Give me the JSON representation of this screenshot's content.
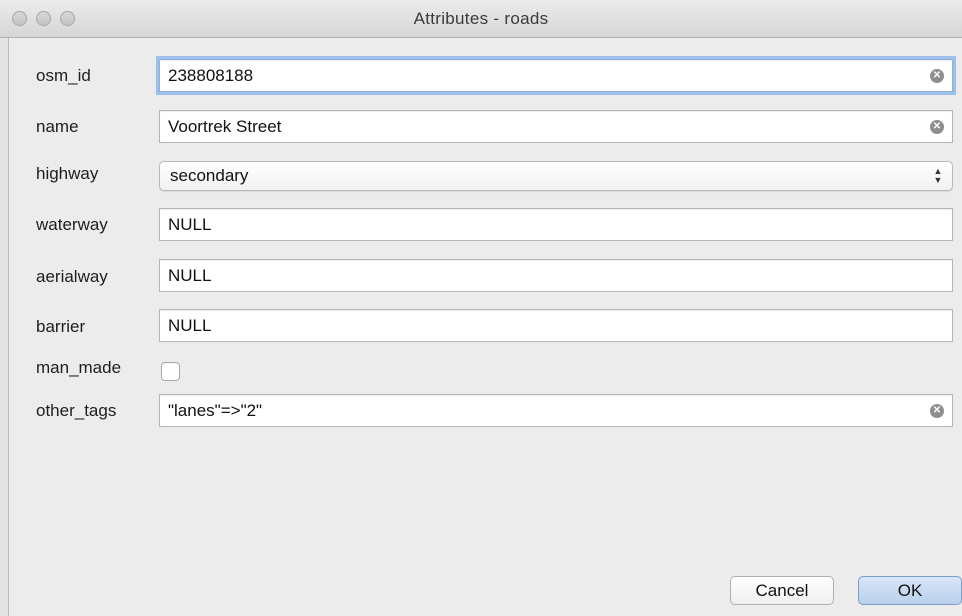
{
  "window": {
    "title": "Attributes - roads"
  },
  "fields": {
    "osm_id": {
      "label": "osm_id",
      "value": "238808188"
    },
    "name": {
      "label": "name",
      "value": "Voortrek Street"
    },
    "highway": {
      "label": "highway",
      "value": "secondary"
    },
    "waterway": {
      "label": "waterway",
      "value": "NULL"
    },
    "aerialway": {
      "label": "aerialway",
      "value": "NULL"
    },
    "barrier": {
      "label": "barrier",
      "value": "NULL"
    },
    "man_made": {
      "label": "man_made",
      "checked": false
    },
    "other_tags": {
      "label": "other_tags",
      "value": "\"lanes\"=>\"2\""
    }
  },
  "buttons": {
    "cancel_label": "Cancel",
    "ok_label": "OK"
  },
  "icons": {
    "clear": "clear-icon",
    "select_arrows": "up-down-arrows-icon"
  }
}
